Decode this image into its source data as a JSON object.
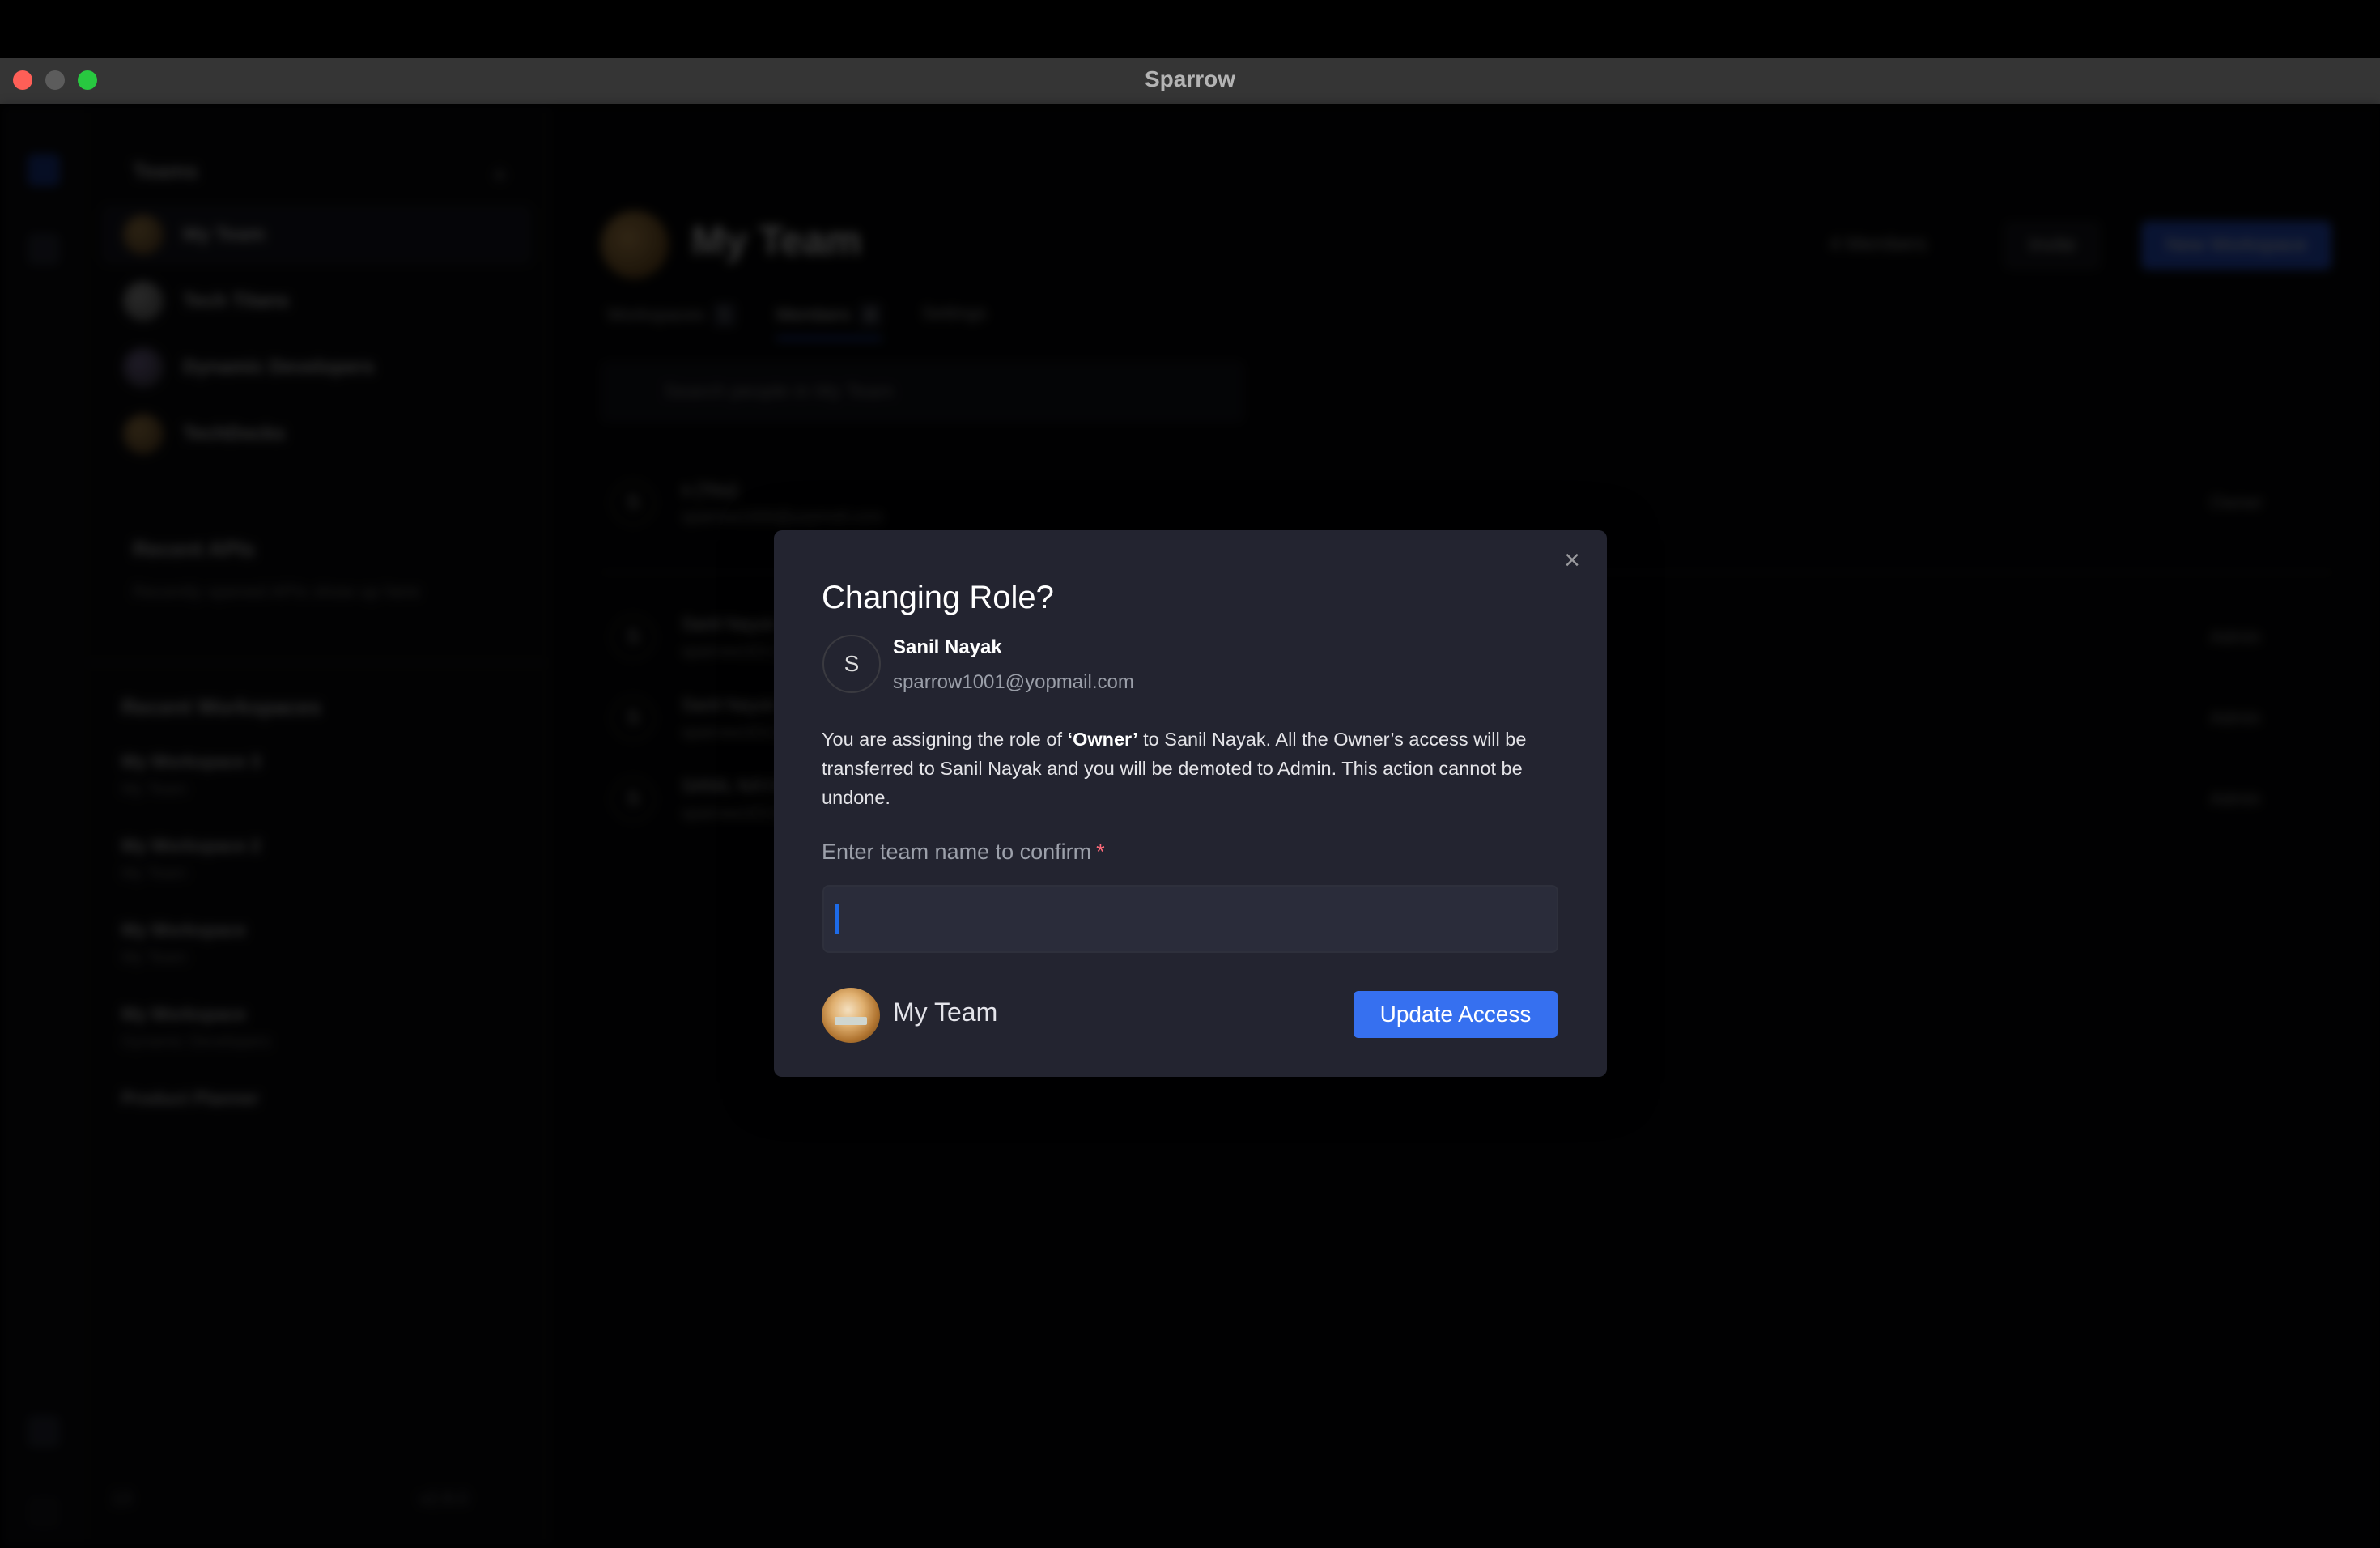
{
  "window": {
    "title": "Sparrow"
  },
  "background": {
    "sidebar": {
      "teams_title": "Teams",
      "add_label": "+",
      "teams": [
        {
          "name": "My Team",
          "active": true
        },
        {
          "name": "Tech Titans",
          "active": false
        },
        {
          "name": "Dynamic Developers",
          "active": false
        },
        {
          "name": "TechDocks",
          "active": false
        }
      ],
      "recent_apis_title": "Recent APIs",
      "recent_apis_hint": "Recently opened APIs show up here",
      "recent_workspaces_title": "Recent Workspaces",
      "workspaces": [
        {
          "name": "My Workspace 3",
          "team": "My Team"
        },
        {
          "name": "My Workspace 2",
          "team": "My Team"
        },
        {
          "name": "My Workspace",
          "team": "My Team"
        },
        {
          "name": "My Workspace",
          "team": "Dynamic Developers"
        }
      ],
      "more_section": "Product Planner",
      "version": "v2.8.0",
      "help_count": "13"
    },
    "main": {
      "team_title": "My Team",
      "members_count": "4 Members",
      "invite_label": "Invite",
      "new_workspace_label": "New Workspace",
      "tabs": [
        {
          "label": "Workspaces",
          "count": "5",
          "active": false
        },
        {
          "label": "Members",
          "count": "4",
          "active": true
        },
        {
          "label": "Settings",
          "count": "",
          "active": false
        }
      ],
      "search_placeholder": "Search people in My Team",
      "members": [
        {
          "initial": "S",
          "name": "s (You)",
          "email": "sparrow1000@yopmail.com",
          "role": "Owner"
        },
        {
          "initial": "S",
          "name": "Sanil Nayak",
          "email": "sparrow1001@yopmail.com",
          "role": "Admin"
        },
        {
          "initial": "S",
          "name": "Sanil Nayak",
          "email": "sparrow1002@yopmail.com",
          "role": "Admin"
        },
        {
          "initial": "S",
          "name": "SANIL NAYAK",
          "email": "sparrow1003@yopmail.com",
          "role": "Admin"
        }
      ]
    }
  },
  "dialog": {
    "title": "Changing Role?",
    "close_icon": "×",
    "user": {
      "initial": "S",
      "name": "Sanil Nayak",
      "email": "sparrow1001@yopmail.com"
    },
    "description": {
      "prefix": "You are assigning the role of ",
      "role": "‘Owner’",
      "suffix": " to Sanil Nayak. All the Owner’s access will be transferred to Sanil Nayak and you will be demoted to Admin. This action cannot be undone."
    },
    "confirm_label": "Enter team name to confirm",
    "required_mark": "*",
    "input_value": "",
    "team_name": "My Team",
    "submit_label": "Update Access"
  },
  "colors": {
    "accent": "#3670f0",
    "dialog_bg": "#232430",
    "input_bg": "#2a2c3a",
    "required": "#ff6b7a",
    "caret": "#1d6be8"
  }
}
